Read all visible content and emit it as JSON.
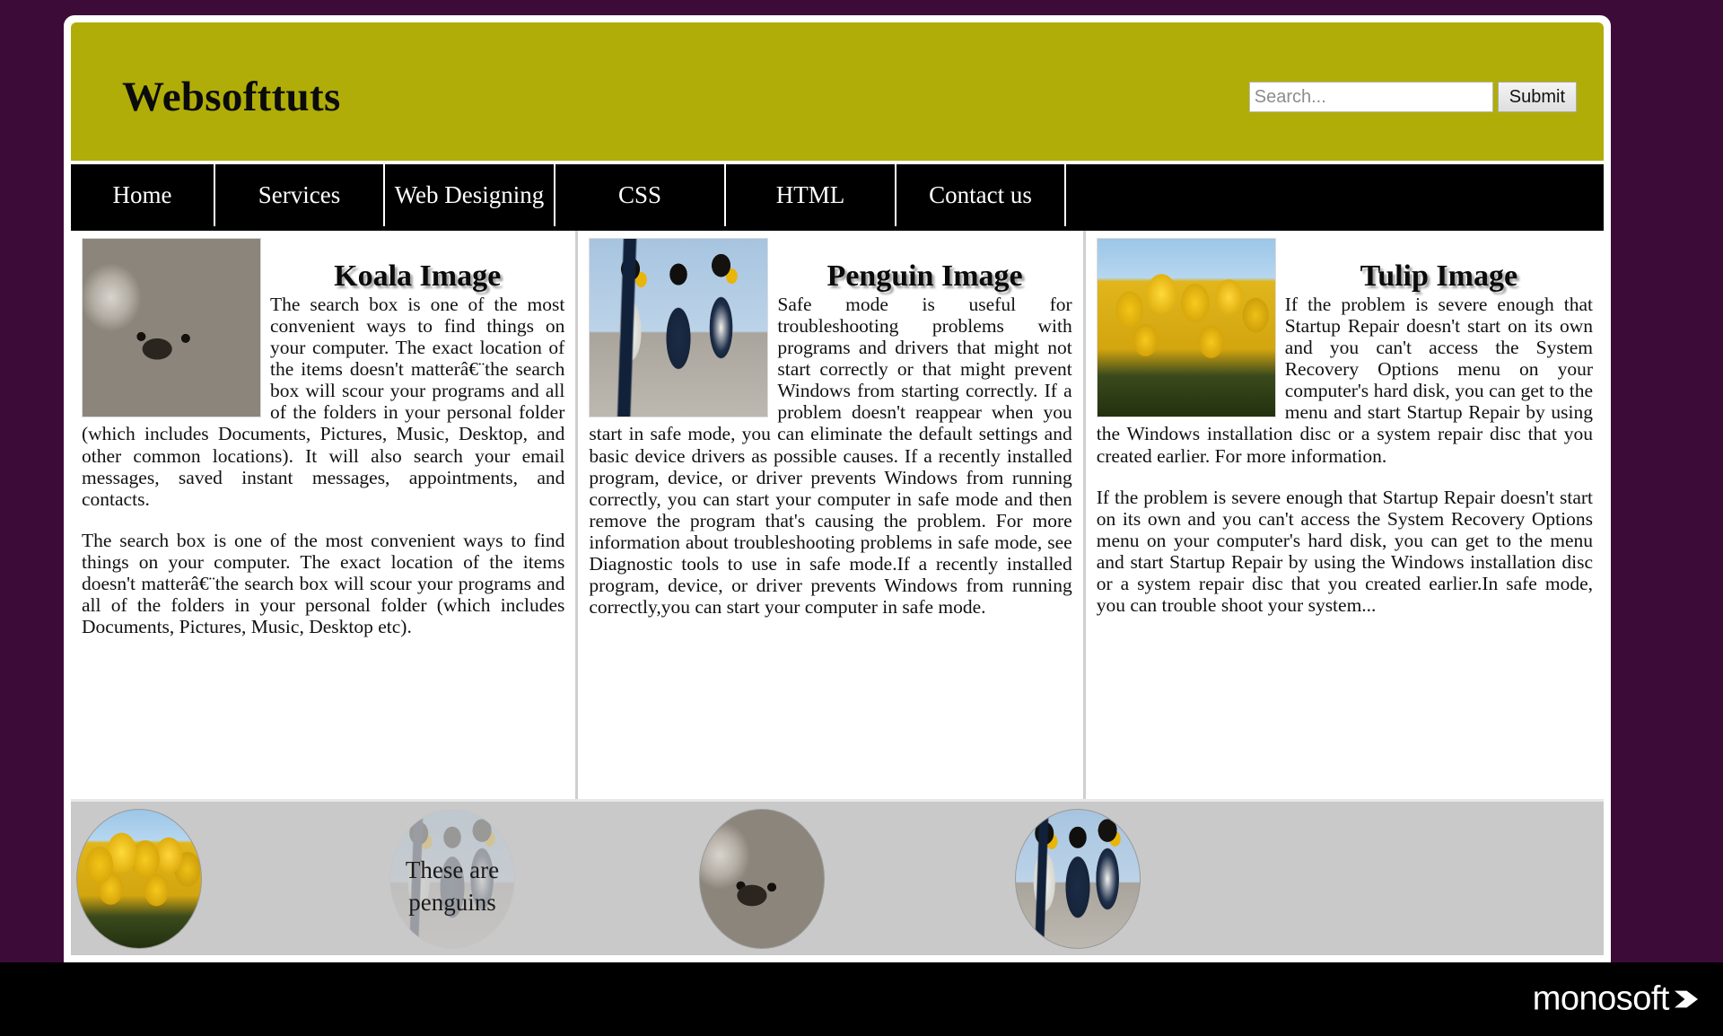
{
  "header": {
    "logo": "Websofttuts",
    "search": {
      "placeholder": "Search...",
      "value": "",
      "submit_label": "Submit"
    }
  },
  "nav": {
    "items": [
      {
        "label": "Home"
      },
      {
        "label": "Services"
      },
      {
        "label": "Web Designing"
      },
      {
        "label": "CSS"
      },
      {
        "label": "HTML"
      },
      {
        "label": "Contact us"
      }
    ]
  },
  "columns": [
    {
      "title": "Koala Image",
      "image_name": "koala-image",
      "paragraphs": [
        "The search box is one of the most convenient ways to find things on your computer. The exact location of the items doesn't matterâ€¨the search box will scour your programs and all of the folders in your personal folder (which includes Documents, Pictures, Music, Desktop, and other common locations). It will also search your email messages, saved instant messages, appointments, and contacts.",
        "The search box is one of the most convenient ways to find things on your computer. The exact location of the items doesn't matterâ€¨the search box will scour your programs and all of the folders in your personal folder (which includes Documents, Pictures, Music, Desktop etc)."
      ]
    },
    {
      "title": "Penguin Image",
      "image_name": "penguin-image",
      "paragraphs": [
        "Safe mode is useful for troubleshooting problems with programs and drivers that might not start correctly or that might prevent Windows from starting correctly. If a problem doesn't reappear when you start in safe mode, you can eliminate the default settings and basic device drivers as possible causes. If a recently installed program, device, or driver prevents Windows from running correctly, you can start your computer in safe mode and then remove the program that's causing the problem. For more information about troubleshooting problems in safe mode, see Diagnostic tools to use in safe mode.If a recently installed program, device, or driver prevents Windows from running correctly,you can start your computer in safe mode."
      ]
    },
    {
      "title": "Tulip Image",
      "image_name": "tulip-image",
      "paragraphs": [
        "If the problem is severe enough that Startup Repair doesn't start on its own and you can't access the System Recovery Options menu on your computer's hard disk, you can get to the menu and start Startup Repair by using the Windows installation disc or a system repair disc that you created earlier. For more information.",
        "If the problem is severe enough that Startup Repair doesn't start on its own and you can't access the System Recovery Options menu on your computer's hard disk, you can get to the menu and start Startup Repair by using the Windows installation disc or a system repair disc that you created earlier.In safe mode, you can trouble shoot your system..."
      ]
    }
  ],
  "footer": {
    "thumbnails": [
      {
        "name": "tulip-thumbnail"
      },
      {
        "name": "penguin-thumbnail-faded"
      },
      {
        "name": "koala-thumbnail"
      },
      {
        "name": "penguin-thumbnail"
      }
    ],
    "caption": "These are penguins"
  },
  "brand": {
    "name": "monosoft"
  },
  "colors": {
    "page_background": "#3d0b38",
    "header_background": "#b0ad09",
    "nav_background": "#000000",
    "content_background": "#ffffff",
    "footer_strip_background": "#c9c9c9",
    "bottom_bar_background": "#000000"
  }
}
